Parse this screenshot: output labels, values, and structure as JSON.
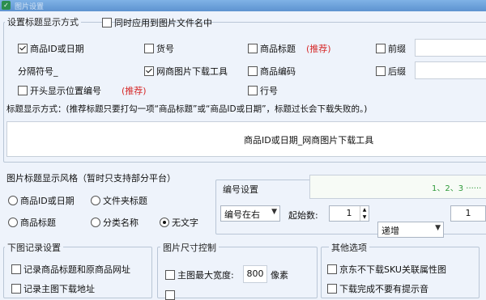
{
  "window": {
    "title": "图片设置",
    "icon": "app-icon"
  },
  "title_settings": {
    "legend": "设置标题显示方式",
    "apply_to_filename": {
      "label": "同时应用到图片文件名中",
      "checked": false
    },
    "checkboxes": [
      {
        "label": "商品ID或日期",
        "checked": true
      },
      {
        "label": "货号",
        "checked": false
      },
      {
        "label": "商品标题",
        "checked": false,
        "badge": "(推荐)"
      },
      {
        "label": "前缀",
        "checked": false
      },
      {
        "label": "网商图片下载工具",
        "checked": true
      },
      {
        "label": "商品编码",
        "checked": false
      },
      {
        "label": "后缀",
        "checked": false
      },
      {
        "label": "开头显示位置编号",
        "checked": false,
        "badge": "(推荐)"
      },
      {
        "label": "行号",
        "checked": false
      }
    ],
    "separator_label": "分隔符号_",
    "hint": "标题显示方式：(推荐标题只要打勾一项“商品标题”或“商品ID或日期”，标题过长会下载失败的。)",
    "preview": "商品ID或日期_网商图片下载工具"
  },
  "style_section": {
    "legend": "图片标题显示风格（暂时只支持部分平台）",
    "radios": [
      {
        "label": "商品ID或日期",
        "checked": false
      },
      {
        "label": "文件夹标题",
        "checked": false
      },
      {
        "label": "商品标题",
        "checked": false
      },
      {
        "label": "分类名称",
        "checked": false
      },
      {
        "label": "无文字",
        "checked": true
      }
    ]
  },
  "numbering": {
    "legend": "编号设置",
    "preview": "1、2、3 ······",
    "position": "编号在右",
    "start_label": "起始数:",
    "start_value": "1",
    "order": "递增",
    "step_value": "1"
  },
  "record_section": {
    "legend": "下图记录设置",
    "items": [
      {
        "label": "记录商品标题和原商品网址",
        "checked": false
      },
      {
        "label": "记录主图下载地址",
        "checked": false
      }
    ]
  },
  "size_section": {
    "legend": "图片尺寸控制",
    "max_width_label": "主图最大宽度:",
    "max_width_value": "800",
    "unit": "像素"
  },
  "other_section": {
    "legend": "其他选项",
    "items": [
      {
        "label": "京东不下载SKU关联属性图",
        "checked": false
      },
      {
        "label": "下载完成不要有提示音",
        "checked": false
      }
    ]
  }
}
